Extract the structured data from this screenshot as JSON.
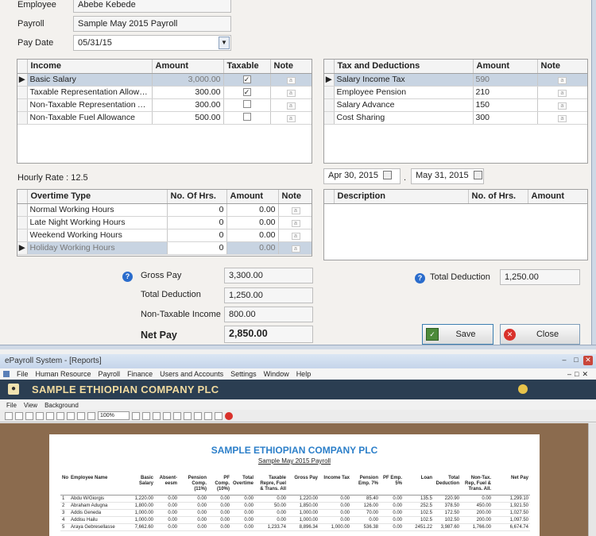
{
  "dialog": {
    "employee_label": "Employee",
    "employee_value": "Abebe Kebede",
    "payroll_label": "Payroll",
    "payroll_value": "Sample May 2015 Payroll",
    "paydate_label": "Pay Date",
    "paydate_value": "05/31/15",
    "income": {
      "headers": [
        "Income",
        "Amount",
        "Taxable",
        "Note"
      ],
      "rows": [
        {
          "name": "Basic Salary",
          "amount": "3,000.00",
          "taxable": true
        },
        {
          "name": "Taxable Representation Allowan...",
          "amount": "300.00",
          "taxable": true
        },
        {
          "name": "Non-Taxable Representation All...",
          "amount": "300.00",
          "taxable": false
        },
        {
          "name": "Non-Taxable Fuel Allowance",
          "amount": "500.00",
          "taxable": false
        }
      ]
    },
    "deductions": {
      "headers": [
        "Tax and Deductions",
        "Amount",
        "Note"
      ],
      "rows": [
        {
          "name": "Salary Income Tax",
          "amount": "590"
        },
        {
          "name": "Employee Pension",
          "amount": "210"
        },
        {
          "name": "Salary Advance",
          "amount": "150"
        },
        {
          "name": "Cost Sharing",
          "amount": "300"
        }
      ]
    },
    "hourly_rate": "Hourly Rate : 12.5",
    "date_from": "Apr 30, 2015",
    "date_sep": ".",
    "date_to": "May 31, 2015",
    "overtime": {
      "headers": [
        "Overtime Type",
        "No. Of Hrs.",
        "Amount",
        "Note"
      ],
      "rows": [
        {
          "name": "Normal Working Hours",
          "hrs": "0",
          "amount": "0.00"
        },
        {
          "name": "Late Night Working Hours",
          "hrs": "0",
          "amount": "0.00"
        },
        {
          "name": "Weekend Working Hours",
          "hrs": "0",
          "amount": "0.00"
        },
        {
          "name": "Holiday Working Hours",
          "hrs": "0",
          "amount": "0.00"
        }
      ]
    },
    "desc_grid": {
      "headers": [
        "Description",
        "No. of Hrs.",
        "Amount"
      ]
    },
    "gross_pay_label": "Gross Pay",
    "gross_pay_value": "3,300.00",
    "total_deduction_label": "Total Deduction",
    "total_deduction_value": "1,250.00",
    "nontaxable_label": "Non-Taxable Income",
    "nontaxable_value": "800.00",
    "net_pay_label": "Net Pay",
    "net_pay_value": "2,850.00",
    "right_total_deduction_label": "Total Deduction",
    "right_total_deduction_value": "1,250.00",
    "save_label": "Save",
    "close_label": "Close"
  },
  "app": {
    "title": "ePayroll System - [Reports]",
    "menu": [
      "File",
      "Human Resource",
      "Payroll",
      "Finance",
      "Users and Accounts",
      "Settings",
      "Window",
      "Help"
    ],
    "company_banner": "SAMPLE ETHIOPIAN COMPANY PLC",
    "report_menu": [
      "File",
      "View",
      "Background"
    ],
    "zoom": "100%"
  },
  "report": {
    "title": "SAMPLE ETHIOPIAN COMPANY PLC",
    "subtitle": "Sample May 2015 Payroll",
    "headers": [
      "No",
      "Employee Name",
      "Basic Salary",
      "Absent-eesm",
      "Pension Comp. (11%)",
      "PF Comp. (10%)",
      "Total Overtime",
      "Taxable Repre, Fuel & Trans. All",
      "Gross Pay",
      "Income Tax",
      "Pension Emp. 7%",
      "PF Emp. 5%",
      "Loan",
      "Total Deduction",
      "Non-Tax. Rep, Fuel & Trans. All.",
      "Net Pay"
    ],
    "rows": [
      [
        "1",
        "Abdu W/Giorgis",
        "1,220.00",
        "0.00",
        "0.00",
        "0.00",
        "0.00",
        "0.00",
        "1,220.00",
        "0.00",
        "85.40",
        "0.00",
        "135.5",
        "220.90",
        "0.00",
        "1,299.10"
      ],
      [
        "2",
        "Abraham Adugna",
        "1,800.00",
        "0.00",
        "0.00",
        "0.00",
        "0.00",
        "50.00",
        "1,850.00",
        "0.00",
        "126.00",
        "0.00",
        "252.5",
        "378.50",
        "450.00",
        "1,921.50"
      ],
      [
        "3",
        "Addis Geneda",
        "1,000.00",
        "0.00",
        "0.00",
        "0.00",
        "0.00",
        "0.00",
        "1,000.00",
        "0.00",
        "70.00",
        "0.00",
        "102.5",
        "172.50",
        "200.00",
        "1,027.50"
      ],
      [
        "4",
        "Addisu Hailu",
        "1,000.00",
        "0.00",
        "0.00",
        "0.00",
        "0.00",
        "0.00",
        "1,000.00",
        "0.00",
        "0.00",
        "0.00",
        "102.5",
        "102.50",
        "200.00",
        "1,097.50"
      ],
      [
        "5",
        "Araya Gebresellasse",
        "7,662.60",
        "0.00",
        "0.00",
        "0.00",
        "0.00",
        "1,233.74",
        "8,896.34",
        "1,000.00",
        "536.38",
        "0.00",
        "2451.22",
        "3,987.60",
        "1,766.00",
        "6,674.74"
      ]
    ]
  }
}
